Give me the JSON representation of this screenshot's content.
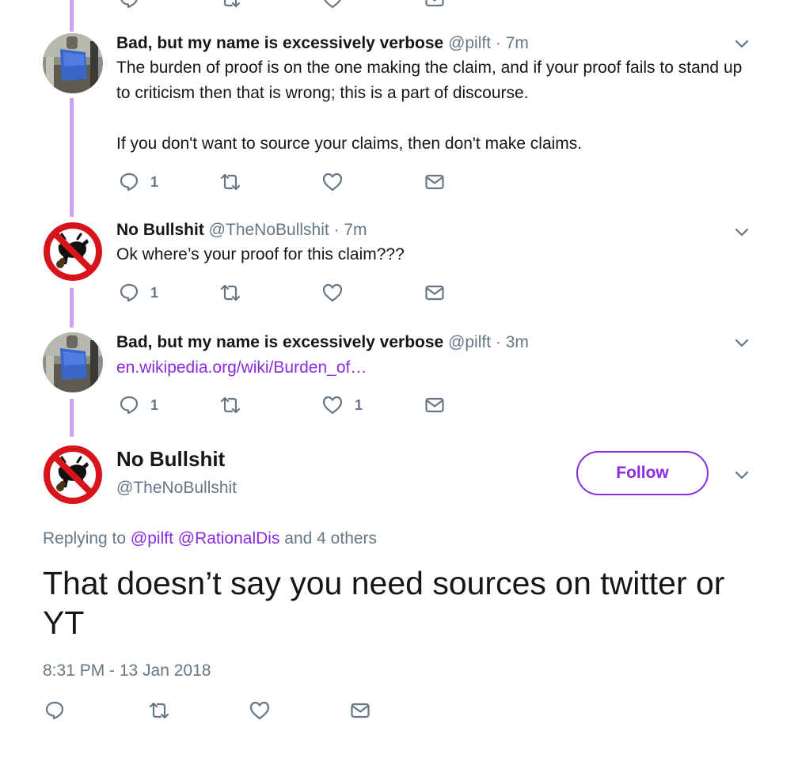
{
  "tweets": [
    {
      "name": "Bad, but my name is excessively verbose",
      "handle": "@pilft",
      "meta": "@pilft · 7m",
      "time": "7m",
      "text_1": "The burden of proof is on the one making the claim, and if your proof fails to stand up to criticism then that is wrong; this is a part of discourse.",
      "text_2": "If you don't want to source your claims, then don't make claims.",
      "reply_count": "1",
      "retweet_count": "",
      "like_count": ""
    },
    {
      "name": "No Bullshit",
      "handle": "@TheNoBullshit",
      "meta": "@TheNoBullshit · 7m",
      "time": "7m",
      "text_1": "Ok where’s your proof for this claim???",
      "reply_count": "1",
      "retweet_count": "",
      "like_count": ""
    },
    {
      "name": "Bad, but my name is excessively verbose",
      "handle": "@pilft",
      "meta": "@pilft · 3m",
      "time": "3m",
      "link": "en.wikipedia.org/wiki/Burden_of…",
      "reply_count": "1",
      "retweet_count": "",
      "like_count": "1"
    }
  ],
  "main_tweet": {
    "name": "No Bullshit",
    "handle": "@TheNoBullshit",
    "follow_label": "Follow",
    "replying_prefix": "Replying to",
    "mention_1": "@pilft",
    "mention_2": "@RationalDis",
    "replying_suffix": "and 4 others",
    "text": "That doesn’t say you need sources on twitter or YT",
    "timestamp": "8:31 PM - 13 Jan 2018"
  },
  "icons": {
    "reply": "reply-icon",
    "retweet": "retweet-icon",
    "like": "heart-icon",
    "message": "envelope-icon",
    "more": "chevron-down-icon"
  },
  "colors": {
    "accent": "#8a2be2",
    "thread_line": "#c9a4f2",
    "secondary_text": "#657786",
    "no_sign_red": "#d7141a"
  }
}
